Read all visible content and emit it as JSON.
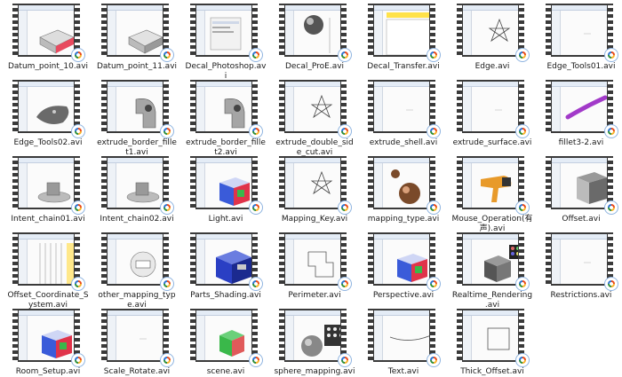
{
  "files": [
    {
      "name": "Datum_point_10.avi",
      "preview": "block-red",
      "accent": "#e84a5f"
    },
    {
      "name": "Datum_point_11.avi",
      "preview": "block-gray",
      "accent": "#9a9a9a"
    },
    {
      "name": "Decal_Photoshop.avi",
      "preview": "dialog",
      "accent": "#d9d9d9"
    },
    {
      "name": "Decal_ProE.avi",
      "preview": "sphere",
      "accent": "#555555"
    },
    {
      "name": "Decal_Transfer.avi",
      "preview": "yellow-window",
      "accent": "#ffe24a"
    },
    {
      "name": "Edge.avi",
      "preview": "star",
      "accent": "#444444"
    },
    {
      "name": "Edge_Tools01.avi",
      "preview": "empty",
      "accent": "#cccccc"
    },
    {
      "name": "Edge_Tools02.avi",
      "preview": "tag",
      "accent": "#666666"
    },
    {
      "name": "extrude_border_fillet1.avi",
      "preview": "part-gray",
      "accent": "#8a8a8a"
    },
    {
      "name": "extrude_border_fillet2.avi",
      "preview": "part-gray",
      "accent": "#8a8a8a"
    },
    {
      "name": "extrude_double_side_cut.avi",
      "preview": "star",
      "accent": "#444444"
    },
    {
      "name": "extrude_shell.avi",
      "preview": "empty",
      "accent": "#cccccc"
    },
    {
      "name": "extrude_surface.avi",
      "preview": "empty",
      "accent": "#cccccc"
    },
    {
      "name": "fillet3-2.avi",
      "preview": "purple",
      "accent": "#a23ac9"
    },
    {
      "name": "Intent_chain01.avi",
      "preview": "cylinder",
      "accent": "#9a9a9a"
    },
    {
      "name": "Intent_chain02.avi",
      "preview": "cylinder",
      "accent": "#9a9a9a"
    },
    {
      "name": "Light.avi",
      "preview": "color-box",
      "accent": "#3a5bd9"
    },
    {
      "name": "Mapping_Key.avi",
      "preview": "star",
      "accent": "#444444"
    },
    {
      "name": "mapping_type.avi",
      "preview": "sphere-brown",
      "accent": "#7a4a2a"
    },
    {
      "name": "Mouse_Operation(有声).avi",
      "preview": "hairdryer",
      "accent": "#e89a2a"
    },
    {
      "name": "Offset.avi",
      "preview": "box-gray",
      "accent": "#6a6a6a"
    },
    {
      "name": "Offset_Coordinate_System.avi",
      "preview": "lines",
      "accent": "#cfcfcf"
    },
    {
      "name": "other_mapping_type.avi",
      "preview": "sphere-white",
      "accent": "#cccccc"
    },
    {
      "name": "Parts_Shading.avi",
      "preview": "box-blue",
      "accent": "#2a3fc4"
    },
    {
      "name": "Perimeter.avi",
      "preview": "outline",
      "accent": "#555555"
    },
    {
      "name": "Perspective.avi",
      "preview": "color-box",
      "accent": "#3a5bd9"
    },
    {
      "name": "Realtime_Rendering.avi",
      "preview": "render-swatches",
      "accent": "#444444"
    },
    {
      "name": "Restrictions.avi",
      "preview": "empty",
      "accent": "#cccccc"
    },
    {
      "name": "Room_Setup.avi",
      "preview": "color-box",
      "accent": "#3a5bd9"
    },
    {
      "name": "Scale_Rotate.avi",
      "preview": "empty",
      "accent": "#cccccc"
    },
    {
      "name": "scene.avi",
      "preview": "cube-color",
      "accent": "#3ab84a"
    },
    {
      "name": "sphere_mapping.avi",
      "preview": "sphere-swatches",
      "accent": "#888888"
    },
    {
      "name": "Text.avi",
      "preview": "curve",
      "accent": "#555555"
    },
    {
      "name": "Thick_Offset.avi",
      "preview": "square",
      "accent": "#555555"
    }
  ]
}
